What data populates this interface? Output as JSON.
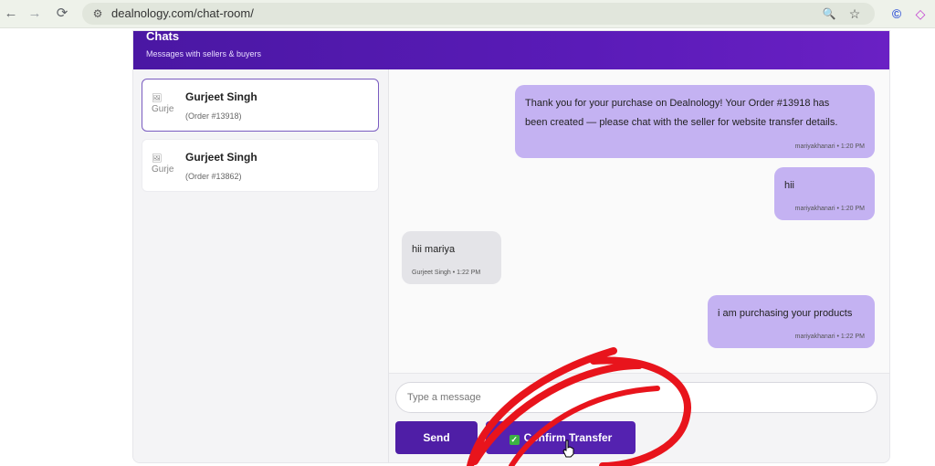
{
  "browser": {
    "url": "dealnology.com/chat-room/",
    "back_icon": "←",
    "forward_icon": "→",
    "reload_icon": "⟳",
    "site_icon": "⚙",
    "zoom_icon": "🔍",
    "star_icon": "☆",
    "ext_icon_1": "©",
    "ext_icon_2": "◇"
  },
  "header": {
    "title": "Chats",
    "subtitle": "Messages with sellers & buyers"
  },
  "contacts": [
    {
      "name": "Gurjeet Singh",
      "order": "(Order #13918)",
      "avatar_alt": "Gurje",
      "active": true
    },
    {
      "name": "Gurjeet Singh",
      "order": "(Order #13862)",
      "avatar_alt": "Gurje",
      "active": false
    }
  ],
  "messages": [
    {
      "direction": "out",
      "line1": "Thank you for your purchase on Dealnology! Your Order #13918 has",
      "line2": "been created — please chat with the seller for website transfer details.",
      "meta": "mariyakhanari • 1:20 PM"
    },
    {
      "direction": "out",
      "line1": "hii",
      "meta": "mariyakhanari • 1:20 PM"
    },
    {
      "direction": "in",
      "line1": "hii mariya",
      "meta": "Gurjeet Singh • 1:22 PM"
    },
    {
      "direction": "out",
      "line1": "i am purchasing your products",
      "meta": "mariyakhanari • 1:22 PM"
    }
  ],
  "composer": {
    "placeholder": "Type a message",
    "send_label": "Send",
    "confirm_label": "Confirm Transfer",
    "confirm_icon": "✓"
  },
  "colors": {
    "header": "#5a1bb8",
    "outgoing_bubble": "#c4b2f2",
    "incoming_bubble": "#e4e4e8",
    "button": "#4f1ea6",
    "annotation": "#e8141c"
  }
}
